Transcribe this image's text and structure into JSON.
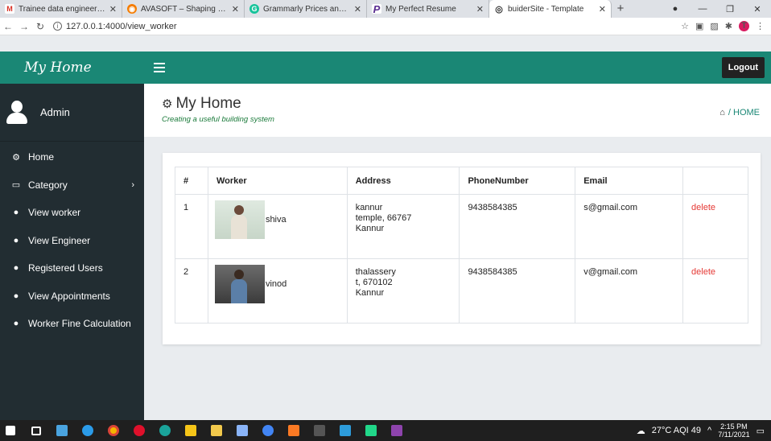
{
  "browser": {
    "tabs": [
      {
        "title": "Trainee data engineer - th",
        "color": "#ffffff",
        "glyph": "M",
        "glyph_color": "#d93025"
      },
      {
        "title": "AVASOFT – Shaping Next",
        "color": "#f57c00",
        "glyph": "◉",
        "glyph_color": "#ffffff"
      },
      {
        "title": "Grammarly Prices and Pla",
        "color": "#15c39a",
        "glyph": "G",
        "glyph_color": "#ffffff"
      },
      {
        "title": "My Perfect Resume",
        "color": "#ffffff",
        "glyph": "P",
        "glyph_color": "#5a2d91"
      },
      {
        "title": "buiderSite - Template",
        "color": "#ffffff",
        "glyph": "◎",
        "glyph_color": "#333333"
      }
    ],
    "url": "127.0.0.1:4000/view_worker",
    "profile_initial": "T"
  },
  "app": {
    "brand": "My Home",
    "user": "Admin",
    "logout": "Logout",
    "menu": [
      {
        "label": "Home",
        "icon": "dashboard-icon",
        "glyph": "⚙"
      },
      {
        "label": "Category",
        "icon": "laptop-icon",
        "glyph": "▭",
        "chevron": "›"
      },
      {
        "label": "View worker",
        "icon": "globe-icon",
        "glyph": "●"
      },
      {
        "label": "View Engineer",
        "icon": "globe-icon",
        "glyph": "●"
      },
      {
        "label": "Registered Users",
        "icon": "globe-icon",
        "glyph": "●"
      },
      {
        "label": "View Appointments",
        "icon": "globe-icon",
        "glyph": "●"
      },
      {
        "label": "Worker Fine Calculation",
        "icon": "globe-icon",
        "glyph": "●"
      }
    ],
    "header": {
      "title": "My Home",
      "subtitle": "Creating a useful building system",
      "breadcrumb_sep": "/",
      "breadcrumb": "HOME"
    },
    "table": {
      "columns": [
        "#",
        "Worker",
        "Address",
        "PhoneNumber",
        "Email",
        ""
      ],
      "rows": [
        {
          "no": "1",
          "name": "shiva",
          "address": [
            "kannur",
            "temple, 66767",
            "Kannur"
          ],
          "phone": "9438584385",
          "email": "s@gmail.com",
          "action": "delete"
        },
        {
          "no": "2",
          "name": "vinod",
          "address": [
            "thalassery",
            "t, 670102",
            "Kannur"
          ],
          "phone": "9438584385",
          "email": "v@gmail.com",
          "action": "delete"
        }
      ]
    }
  },
  "taskbar": {
    "weather": "27°C  AQI 49",
    "time": "2:15 PM",
    "date": "7/11/2021"
  },
  "colors": {
    "accent": "#1a8775",
    "sidebar": "#222d32",
    "delete": "#e53935"
  }
}
